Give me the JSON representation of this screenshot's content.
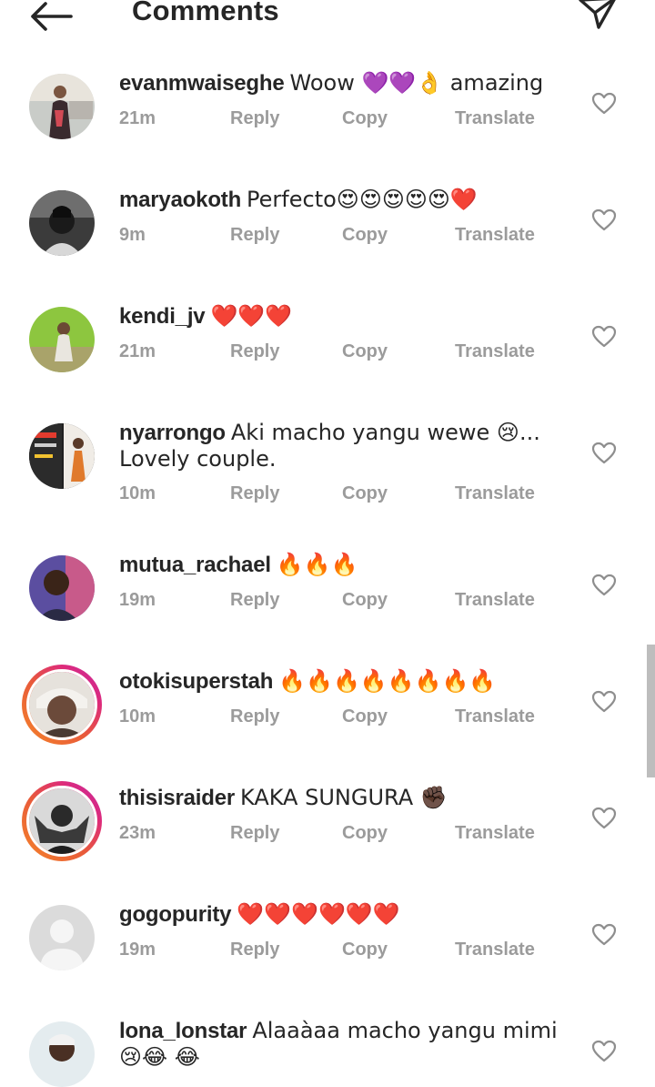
{
  "header": {
    "title": "Comments",
    "back_icon": "arrow-left-icon",
    "send_icon": "paper-plane-icon"
  },
  "actions": {
    "reply": "Reply",
    "copy": "Copy",
    "translate": "Translate"
  },
  "comments": [
    {
      "username": "evanmwaiseghe",
      "text": "Woow 💜💜👌 amazing",
      "time": "21m"
    },
    {
      "username": "maryaokoth",
      "text": "Perfecto😍😍😍😍😍❤️",
      "time": "9m"
    },
    {
      "username": "kendi_jv",
      "text": "❤️❤️❤️",
      "time": "21m"
    },
    {
      "username": "nyarrongo",
      "text": "Aki macho yangu wewe 😢... Lovely couple.",
      "time": "10m"
    },
    {
      "username": "mutua_rachael",
      "text": "🔥🔥🔥",
      "time": "19m"
    },
    {
      "username": "otokisuperstah",
      "text": "🔥🔥🔥🔥🔥🔥🔥🔥",
      "time": "10m"
    },
    {
      "username": "thisisraider",
      "text": "KAKA SUNGURA ✊🏿",
      "time": "23m"
    },
    {
      "username": "gogopurity",
      "text": "❤️❤️❤️❤️❤️❤️",
      "time": "19m"
    },
    {
      "username": "lona_lonstar",
      "text": "Alaaàaa macho yangu mimi😢😂 😂",
      "time": ""
    }
  ],
  "colors": {
    "text": "#262626",
    "meta": "#9b9b9b",
    "story_ring_start": "#f58529",
    "story_ring_end": "#c32aa3",
    "scrollbar": "#bdbdbd"
  },
  "icons": {
    "like": "heart-outline-icon"
  }
}
